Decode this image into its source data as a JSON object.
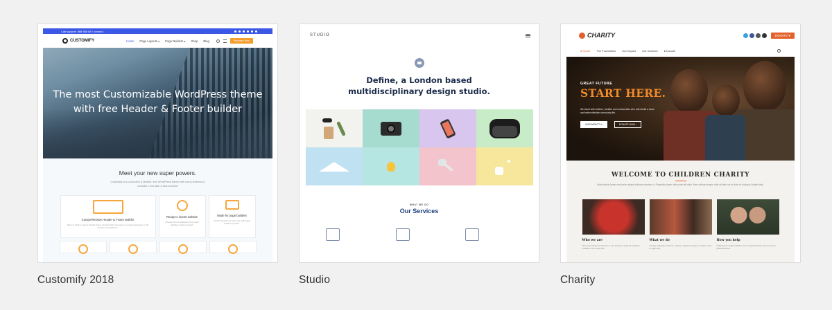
{
  "themes": [
    {
      "name": "Customify 2018",
      "preview": {
        "topbar_text": "Call support: 888 888 88 / contact ↓",
        "logo": "CUSTOMIFY",
        "menu": [
          "Home",
          "Page Layouts ▾",
          "Page Builders ▾",
          "Shop",
          "Blog"
        ],
        "cta": "Purchase Now",
        "hero_title": "The most Customizable WordPress theme with free Header & Footer builder",
        "section_title": "Meet your new super powers.",
        "section_text": "Customify is a productive & flexible, free WordPress theme with many features to consider. Let's take a look at a few:",
        "features": [
          {
            "title": "Comprehensive Header & Footer Builder",
            "text": "Easy to build a custom header footer and just click your way to a great experience on all devices and platforms."
          },
          {
            "title": "Ready to import website",
            "text": "Choose from a collection of pre-built websites ready to import."
          },
          {
            "title": "Made for page builders",
            "text": "Add and build your fancy site with page builders you like."
          }
        ]
      }
    },
    {
      "name": "Studio",
      "preview": {
        "brand": "STUDIO",
        "headline_line1": "Define, a London based",
        "headline_line2": "multidisciplinary design studio.",
        "services_eyebrow": "WHAT WE DO",
        "services_title": "Our Services",
        "tile_colors": [
          "#f2f2ef",
          "#a6dcd0",
          "#d9c6ee",
          "#c9ecc8",
          "#bfe1f2",
          "#b6e6e2",
          "#f3c4cc",
          "#f6e79c"
        ]
      }
    },
    {
      "name": "Charity",
      "preview": {
        "logo": "CHARITY",
        "donate": "DONATE ♥",
        "menu": [
          "● Home",
          "The Foundation",
          "Our Impact",
          "Get Involved",
          "● Donate"
        ],
        "hero_small": "GREAT FUTURE",
        "hero_big": "START HERE.",
        "hero_desc": "We stand with children, families and communities who will rebuild a clean and better effective community life.",
        "btn_primary": "OUR IMPACT ⊙",
        "btn_secondary": "DONATE NOW ›",
        "welcome_title": "WELCOME TO CHILDREN CHARITY",
        "welcome_text": "Morbi ibenis lorem nerit enim, aliqua dulisque omnium ut. Phasellus lorem nibh porta ulti dolor. Nam ultrices tempor nibh ad labu cor ut dolor et dulisque lobortis felis.",
        "columns": [
          {
            "title": "Who we are",
            "text": "Nemo pert lungo fermentum et nisi. Praesent pulvinar faucibus curabitur sed mollis dum."
          },
          {
            "title": "What we do",
            "text": "Congue vulputate ut lacus. Vivamus aliquam tempus in sapien nunc ut eget odio."
          },
          {
            "title": "How you help",
            "text": "Ullamcorper magna efficitur lorem euismod lectus. Donec auctor placerat lectus."
          }
        ]
      }
    }
  ]
}
